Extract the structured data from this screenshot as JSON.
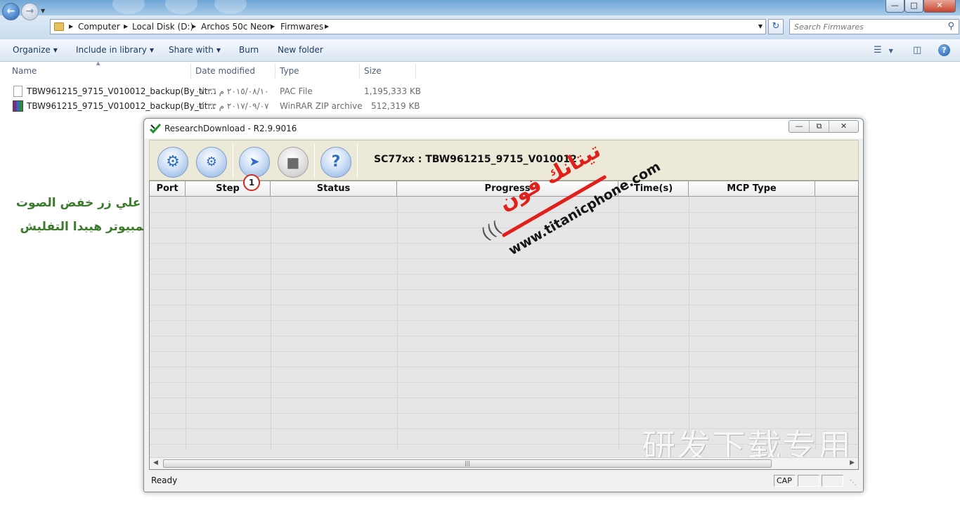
{
  "explorer": {
    "breadcrumbs": [
      "Computer",
      "Local Disk (D:)",
      "Archos 50c Neon",
      "Firmwares"
    ],
    "search_placeholder": "Search Firmwares",
    "commands": {
      "organize": "Organize",
      "include_in_library": "Include in library",
      "share_with": "Share with",
      "burn": "Burn",
      "new_folder": "New folder"
    },
    "columns": {
      "name": "Name",
      "date_modified": "Date modified",
      "type": "Type",
      "size": "Size"
    },
    "files": [
      {
        "name": "TBW961215_9715_V010012_backup(By_tit...",
        "date": "٢٠١٥/٠٨/١٠ م ٠٧:٣٦",
        "type": "PAC File",
        "size": "1,195,333 KB",
        "icon": "pac-file-icon"
      },
      {
        "name": "TBW961215_9715_V010012_backup(By_tit...",
        "date": "٢٠١٧/٠٩/٠٧ م ٠٥:٣٣",
        "type": "WinRAR ZIP archive",
        "size": "512,319 KB",
        "icon": "winrar-archive-icon"
      }
    ]
  },
  "annotation": {
    "line1": "اضغط هنا ثم اضغط علي زر خفض الصوت",
    "line2": "ثم وصل الهاتف بالكمبيوتر هيبدا التفليش",
    "badge": "1"
  },
  "research_download": {
    "title": "ResearchDownload - R2.9.9016",
    "file_label": "SC77xx : TBW961215_9715_V010012",
    "toolbar_icons": [
      "settings-gear-icon",
      "settings-gears-icon",
      "start-download-icon",
      "stop-icon",
      "help-icon"
    ],
    "columns": [
      "Port",
      "Step",
      "Status",
      "Progress",
      "Time(s)",
      "MCP Type"
    ],
    "status_text": "Ready",
    "status_panes": [
      "CAP",
      "",
      ""
    ],
    "background_watermark": "研发下载专用"
  },
  "watermark_logo": {
    "arabic": "تيتانك فون",
    "url": "www.titanicphone.com",
    "accent_color": "#e2201b"
  }
}
